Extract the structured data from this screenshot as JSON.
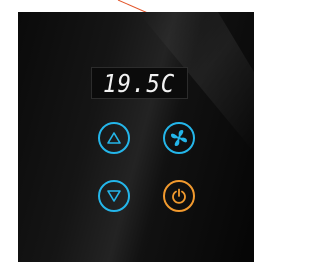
{
  "display": {
    "temperature": "19.5C"
  },
  "buttons": {
    "up": {
      "icon": "triangle-up-icon"
    },
    "fan": {
      "icon": "fan-icon"
    },
    "down": {
      "icon": "triangle-down-icon"
    },
    "power": {
      "icon": "power-icon"
    }
  },
  "colors": {
    "panel": "#111111",
    "accent_blue": "#24b6ea",
    "accent_orange": "#f29a2e",
    "display_text": "#f2f2f2",
    "wire": "#e2552a"
  }
}
